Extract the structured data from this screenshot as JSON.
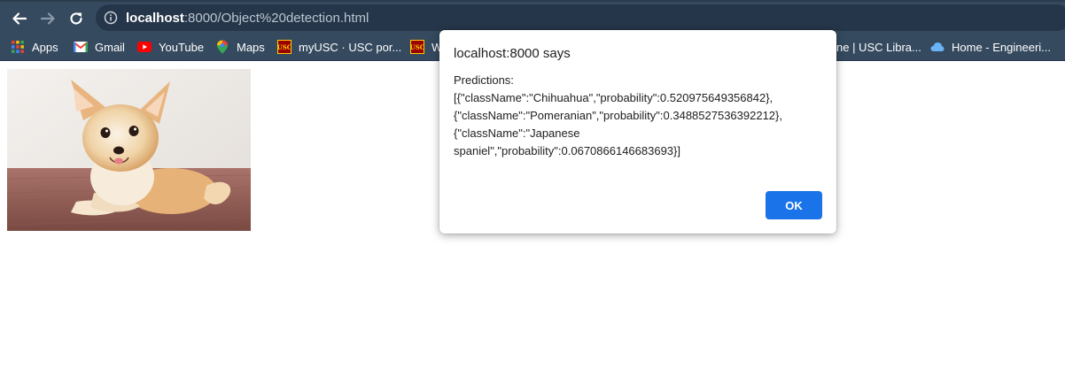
{
  "browser": {
    "url": {
      "host": "localhost",
      "rest": ":8000/Object%20detection.html"
    },
    "icons": {
      "back": "back-arrow-icon",
      "forward": "forward-arrow-icon",
      "reload": "reload-icon",
      "info": "info-icon"
    }
  },
  "bookmarks": [
    {
      "label": "Apps",
      "icon": "apps-grid-icon"
    },
    {
      "label": "Gmail",
      "icon": "gmail-icon"
    },
    {
      "label": "YouTube",
      "icon": "youtube-icon"
    },
    {
      "label": "Maps",
      "icon": "maps-icon"
    },
    {
      "label": "myUSC · USC por...",
      "icon": "usc-icon"
    },
    {
      "label": "W",
      "icon": "usc-icon"
    },
    {
      "label": "ne | USC Libra...",
      "icon": ""
    },
    {
      "label": "Home - Engineeri...",
      "icon": "cloud-icon"
    }
  ],
  "page": {
    "image": "chihuahua-dog-photo"
  },
  "dialog": {
    "title": "localhost:8000 says",
    "label": "Predictions:",
    "lines": [
      "[{\"className\":\"Chihuahua\",\"probability\":0.520975649356842},",
      "{\"className\":\"Pomeranian\",\"probability\":0.3488527536392212},",
      "{\"className\":\"Japanese",
      "spaniel\",\"probability\":0.0670866146683693}]"
    ],
    "ok_label": "OK"
  },
  "colors": {
    "toolbar": "#354a5f",
    "omnibox": "#26364a",
    "ok_button": "#1a73e8"
  }
}
